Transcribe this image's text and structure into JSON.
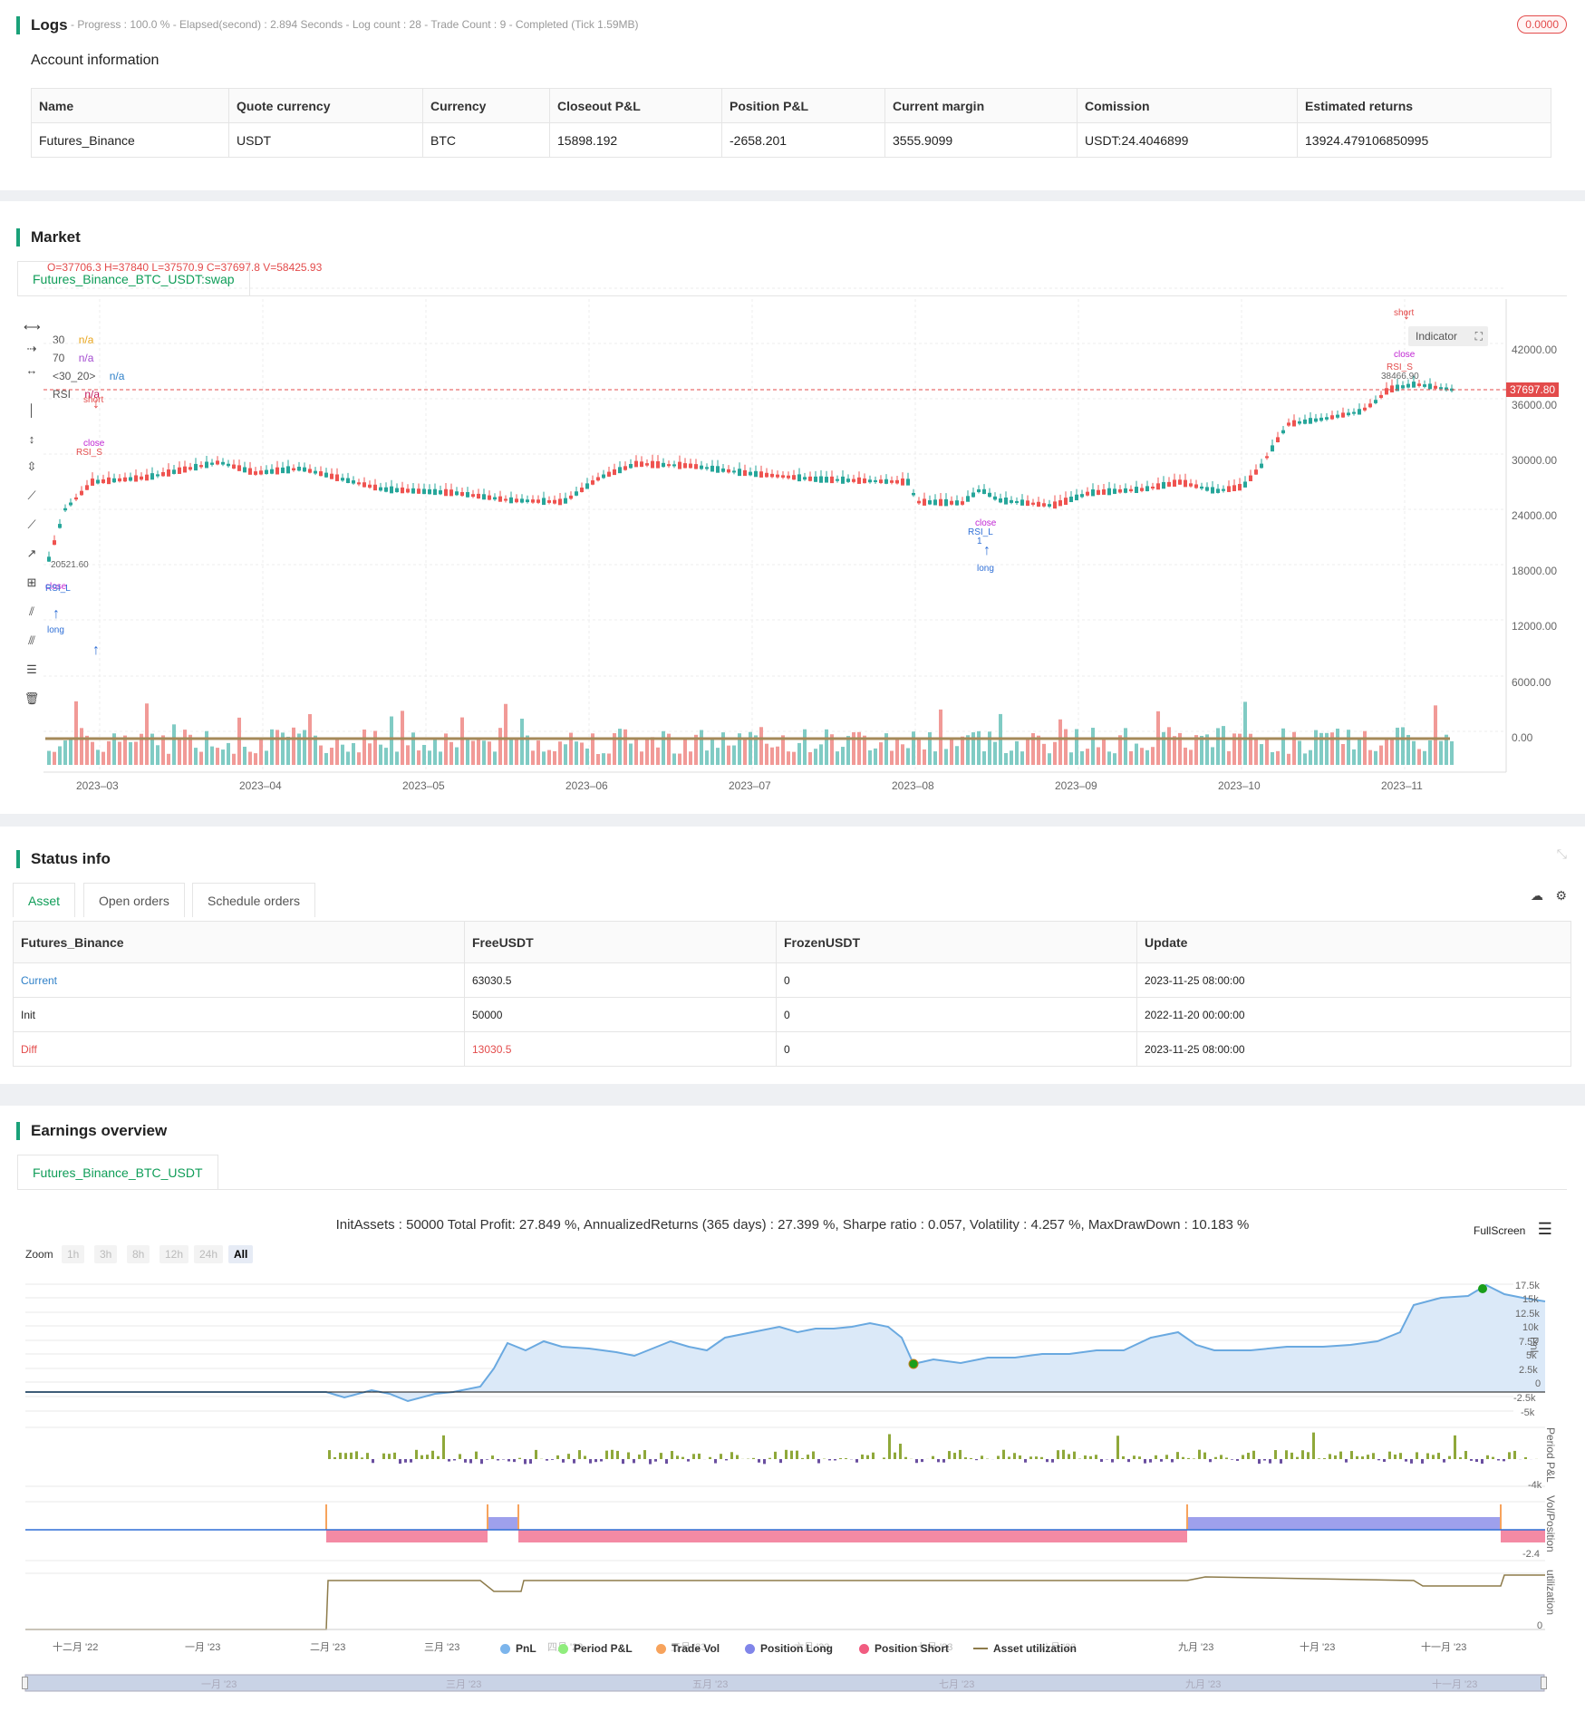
{
  "logs": {
    "title": "Logs",
    "meta": "- Progress : 100.0 % - Elapsed(second) : 2.894  Seconds - Log count : 28 - Trade Count : 9 - Completed (Tick 1.59MB)",
    "badge": "0.0000"
  },
  "account": {
    "title": "Account information",
    "headers": [
      "Name",
      "Quote currency",
      "Currency",
      "Closeout P&L",
      "Position P&L",
      "Current margin",
      "Comission",
      "Estimated returns"
    ],
    "row": [
      "Futures_Binance",
      "USDT",
      "BTC",
      "15898.192",
      "-2658.201",
      "3555.9099",
      "USDT:24.4046899",
      "13924.479106850995"
    ]
  },
  "market": {
    "title": "Market",
    "tab": "Futures_Binance_BTC_USDT:swap",
    "ohlc": "O=37706.3 H=37840 L=37570.9 C=37697.8 V=58425.93",
    "legend": [
      {
        "label": "30",
        "value": "n/a"
      },
      {
        "label": "70",
        "value": "n/a"
      },
      {
        "label": "<30_20>",
        "value": "n/a"
      },
      {
        "label": "RSI",
        "value": "n/a"
      }
    ],
    "indicator_btn": "Indicator",
    "price_tag": "37697.80",
    "yticks": [
      "42000.00",
      "36000.00",
      "30000.00",
      "24000.00",
      "18000.00",
      "12000.00",
      "6000.00",
      "0.00"
    ],
    "xticks": [
      "2023–03",
      "2023–04",
      "2023–05",
      "2023–06",
      "2023–07",
      "2023–08",
      "2023–09",
      "2023–10",
      "2023–11"
    ],
    "annotations": {
      "short1": "short",
      "close1": "close",
      "rsi_s1": "RSI_S",
      "long1": "long",
      "close2": "close",
      "rsi_l1": "RSI_L",
      "long2": "long",
      "close3": "close",
      "rsi_l2": "RSI_L",
      "short2": "short",
      "close4": "close",
      "rsi_s2": "RSI_S",
      "price_a": "20521.60",
      "price_b": "38466.90",
      "one": "1"
    }
  },
  "status": {
    "title": "Status info",
    "tabs": [
      "Asset",
      "Open orders",
      "Schedule orders"
    ],
    "headers": [
      "Futures_Binance",
      "FreeUSDT",
      "FrozenUSDT",
      "Update"
    ],
    "rows": [
      [
        "Current",
        "63030.5",
        "0",
        "2023-11-25 08:00:00"
      ],
      [
        "Init",
        "50000",
        "0",
        "2022-11-20 00:00:00"
      ],
      [
        "Diff",
        "13030.5",
        "0",
        "2023-11-25 08:00:00"
      ]
    ]
  },
  "earnings": {
    "title": "Earnings overview",
    "tab": "Futures_Binance_BTC_USDT",
    "summary": "InitAssets : 50000 Total Profit: 27.849 %, AnnualizedReturns (365 days) : 27.399 %, Sharpe ratio : 0.057, Volatility : 4.257 %, MaxDrawDown : 10.183 %",
    "fullscreen": "FullScreen",
    "zoom_label": "Zoom",
    "zoom_buttons": [
      "1h",
      "3h",
      "8h",
      "12h",
      "24h",
      "All"
    ],
    "pnl_ticks": [
      "17.5k",
      "15k",
      "12.5k",
      "10k",
      "7.5k",
      "5k",
      "2.5k",
      "0",
      "-2.5k",
      "-5k"
    ],
    "axis_titles": [
      "PnL",
      "Period P&L",
      "Vol/Position",
      "utilization"
    ],
    "period_tick": "-4k",
    "vol_tick": "-2.4",
    "util_tick": "0",
    "xticks": [
      "十二月 '22",
      "一月 '23",
      "二月 '23",
      "三月 '23",
      "四月 '23",
      "五月 '23",
      "六月 '23",
      "七月 '23",
      "八月 '23",
      "九月 '23",
      "十月 '23",
      "十一月 '23"
    ],
    "nav_ticks": [
      "一月 '23",
      "三月 '23",
      "五月 '23",
      "七月 '23",
      "九月 '23",
      "十一月 '23"
    ],
    "legend": [
      {
        "label": "PnL",
        "color": "#7cb5ec"
      },
      {
        "label": "Period P&L",
        "color": "#90ed7d"
      },
      {
        "label": "Trade Vol",
        "color": "#f7a35c"
      },
      {
        "label": "Position Long",
        "color": "#8085e9"
      },
      {
        "label": "Position Short",
        "color": "#f15c80"
      },
      {
        "label": "Asset utilization",
        "color": "#8d7b4a"
      }
    ]
  }
}
